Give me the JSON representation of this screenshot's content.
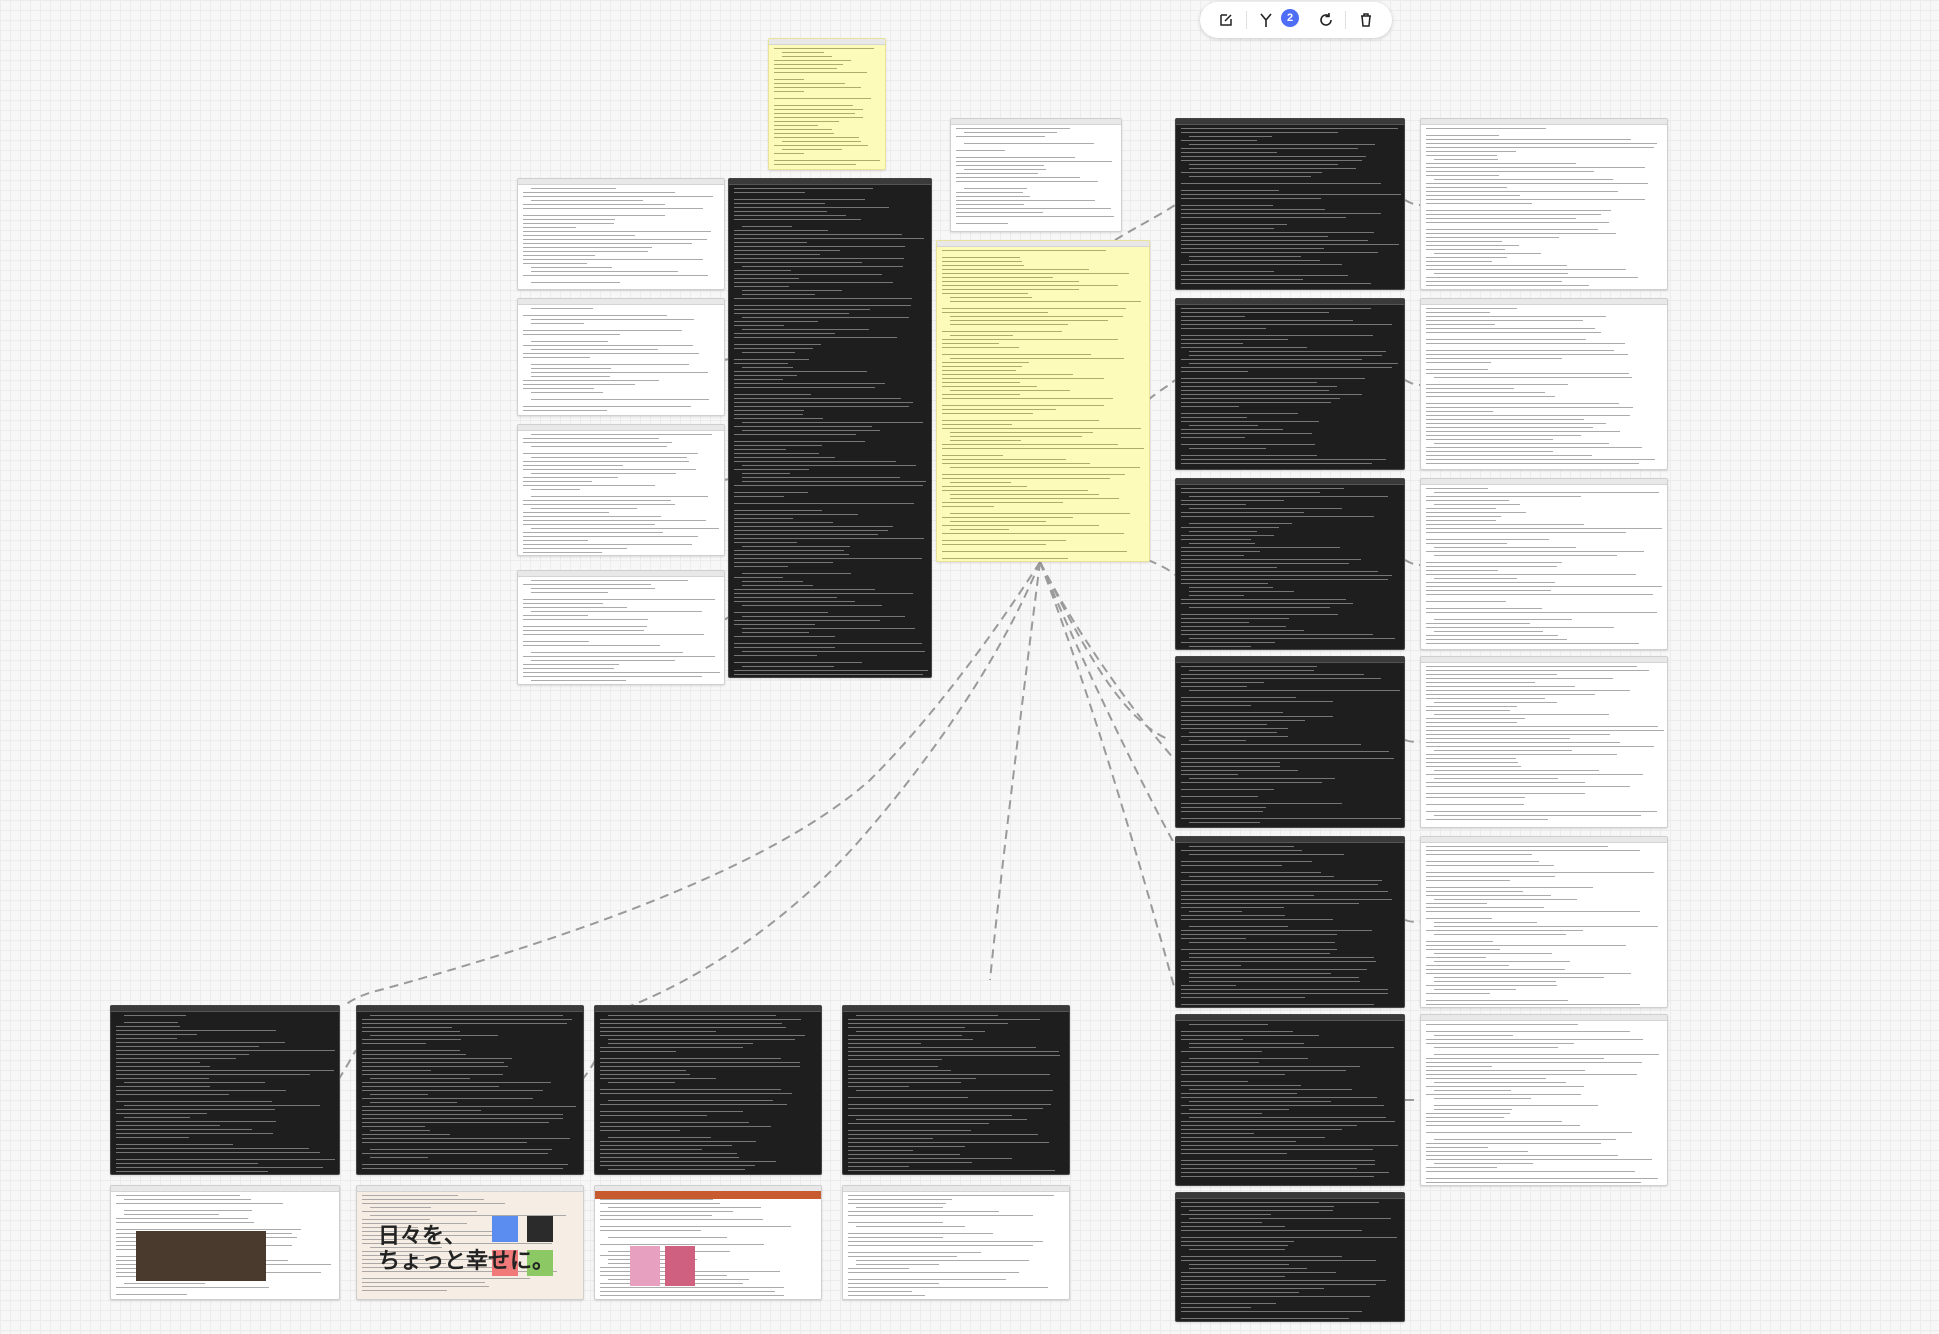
{
  "toolbar": {
    "buttons": [
      {
        "name": "edit-icon",
        "label": ""
      },
      {
        "name": "branch-icon",
        "label": ""
      },
      {
        "name": "refresh-icon",
        "label": ""
      },
      {
        "name": "trash-icon",
        "label": ""
      }
    ],
    "branch_count": "2"
  },
  "poster": {
    "line1": "日々を、",
    "line2": "ちょっと幸せに。"
  },
  "colors": {
    "canvas": "#f7f7f7",
    "terminal": "#1e1e1e",
    "note": "#fdfbb9",
    "accent": "#4f6ef7",
    "edge": "#9a9a9a"
  }
}
